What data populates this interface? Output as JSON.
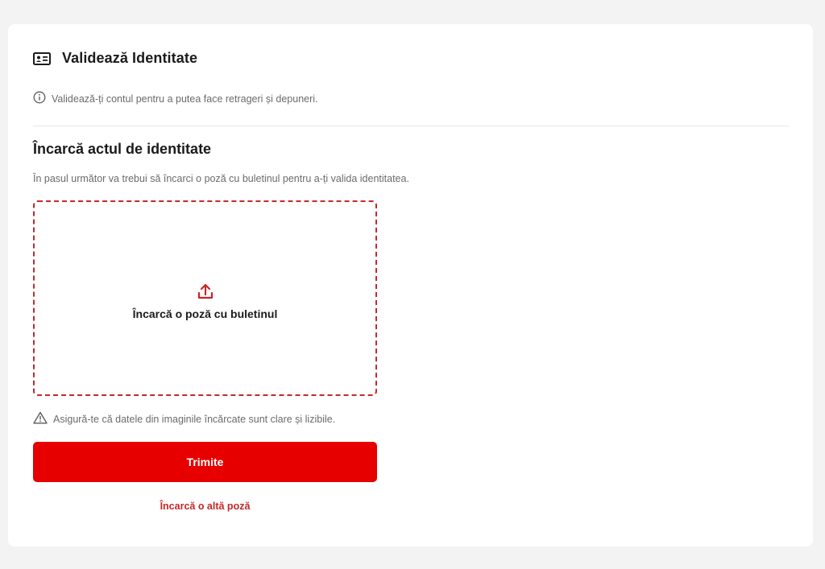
{
  "header": {
    "title": "Validează Identitate",
    "icon": "id-card-icon"
  },
  "info": {
    "icon": "info-icon",
    "text": "Validează-ți contul pentru a putea face retrageri și depuneri."
  },
  "upload_section": {
    "title": "Încarcă actul de identitate",
    "description": "În pasul următor va trebui să încarci o poză cu buletinul pentru a-ți valida identitatea.",
    "dropzone": {
      "icon": "upload-icon",
      "label": "Încarcă o poză cu buletinul"
    },
    "warning": {
      "icon": "warning-icon",
      "text": "Asigură-te că datele din imaginile încărcate sunt clare și lizibile."
    },
    "submit_label": "Trimite",
    "alt_upload_label": "Încarcă o altă poză"
  },
  "colors": {
    "accent": "#e60000",
    "accent_dark": "#c62828",
    "background": "#f3f3f3",
    "card": "#ffffff",
    "muted_text": "#6b6b6b"
  }
}
